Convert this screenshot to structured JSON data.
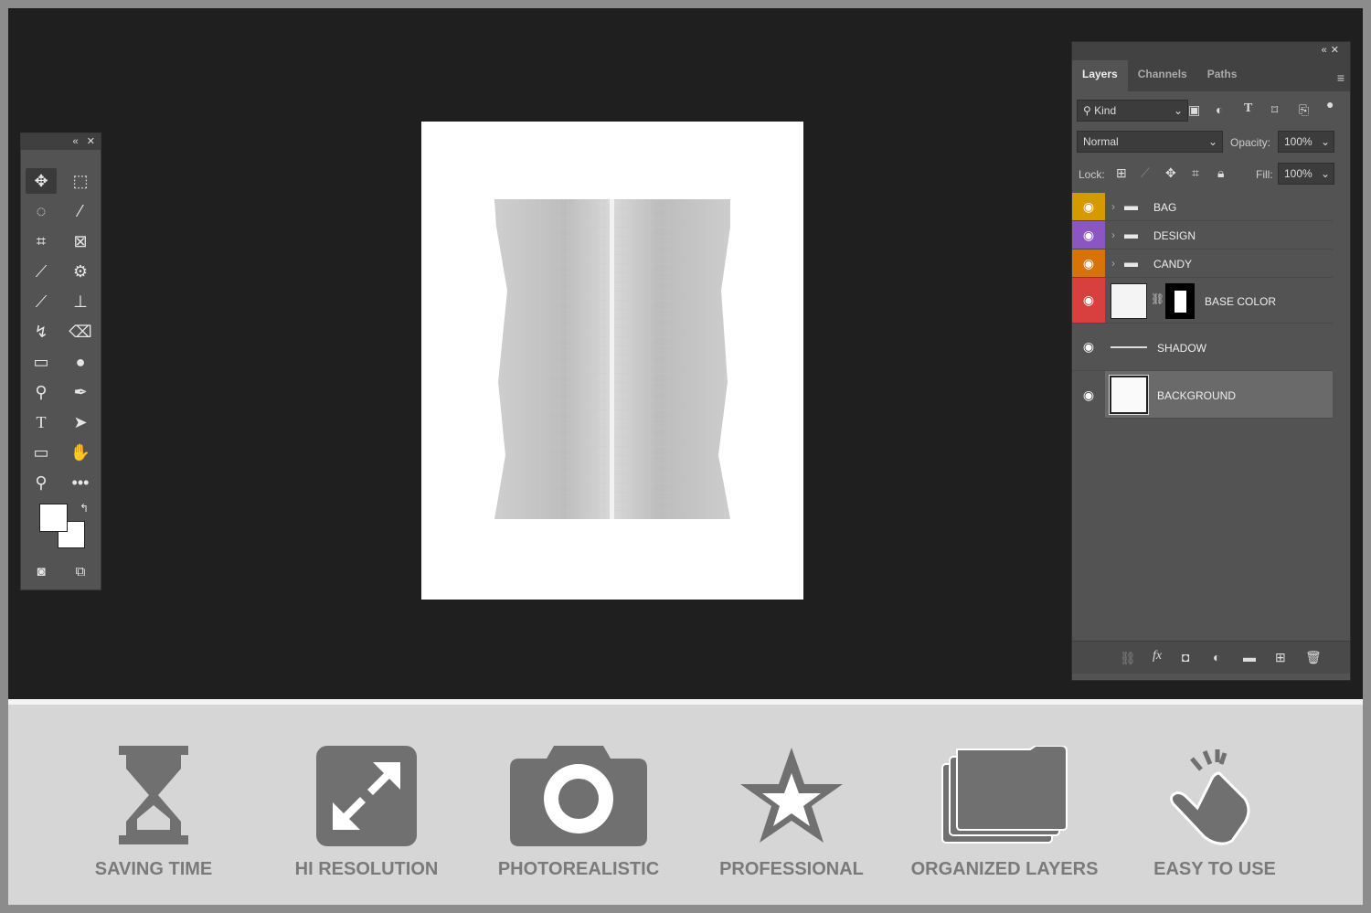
{
  "toolbar": {
    "tools": [
      "move",
      "marquee",
      "lasso",
      "magic-wand",
      "crop",
      "frame",
      "eyedropper",
      "patch",
      "brush",
      "stamp",
      "history-brush",
      "eraser",
      "gradient",
      "blur",
      "dodge",
      "pen",
      "type",
      "path-select",
      "rectangle",
      "hand",
      "zoom",
      "more"
    ]
  },
  "layers_panel": {
    "tabs": [
      "Layers",
      "Channels",
      "Paths"
    ],
    "filter_label": "Kind",
    "blend_mode": "Normal",
    "opacity_label": "Opacity:",
    "opacity": "100%",
    "lock_label": "Lock:",
    "fill_label": "Fill:",
    "fill": "100%",
    "layers": [
      {
        "name": "BAG",
        "type": "group",
        "color": "#d49a00"
      },
      {
        "name": "DESIGN",
        "type": "group",
        "color": "#8b55c2"
      },
      {
        "name": "CANDY",
        "type": "group",
        "color": "#d8730a"
      },
      {
        "name": "BASE COLOR",
        "type": "layer-with-mask",
        "color": "#d84040"
      },
      {
        "name": "SHADOW",
        "type": "layer",
        "color": ""
      },
      {
        "name": "BACKGROUND",
        "type": "layer",
        "color": "",
        "selected": true
      }
    ]
  },
  "features": [
    {
      "label": "SAVING TIME",
      "icon": "hourglass-icon"
    },
    {
      "label": "HI RESOLUTION",
      "icon": "expand-icon"
    },
    {
      "label": "PHOTOREALISTIC",
      "icon": "camera-icon"
    },
    {
      "label": "PROFESSIONAL",
      "icon": "star-icon"
    },
    {
      "label": "ORGANIZED LAYERS",
      "icon": "folders-icon"
    },
    {
      "label": "EASY TO USE",
      "icon": "tap-hand-icon"
    }
  ]
}
